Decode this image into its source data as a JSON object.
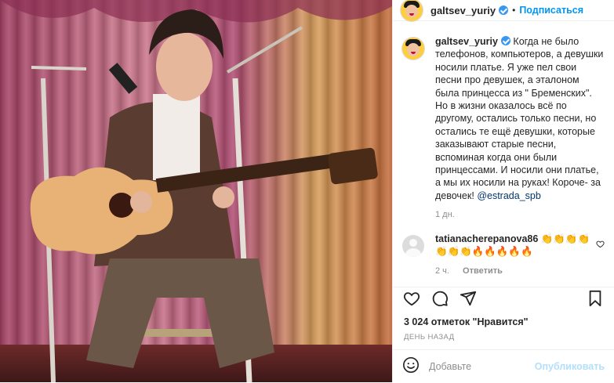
{
  "header": {
    "username": "galtsev_yuriy",
    "separator": "•",
    "follow_label": "Подписаться"
  },
  "caption": {
    "username": "galtsev_yuriy",
    "text": "Когда не было телефонов, компьютеров, а девушки носили платье. Я уже пел свои песни про девушек, а эталоном была принцесса из \" Бременских\". Но в жизни оказалось всё по другому, остались только песни, но остались те ещё девушки, которые заказывают старые песни, вспоминая когда они были принцессами. И носили они платье, а мы их носили на руках! Короче- за девочек! ",
    "mention": "@estrada_spb",
    "time": "1 дн."
  },
  "comment": {
    "username": "tatianacherepanova86",
    "text": "👏👏👏👏👏👏👏🔥🔥🔥🔥🔥",
    "time": "2 ч.",
    "reply_label": "Ответить"
  },
  "likes": "3 024 отметок \"Нравится\"",
  "date": "ДЕНЬ НАЗАД",
  "add_comment": {
    "placeholder": "Добавьте",
    "publish_label": "Опубликовать"
  },
  "icons": {
    "like": "heart-icon",
    "comment": "comment-icon",
    "share": "share-icon",
    "save": "bookmark-icon",
    "emoji": "emoji-icon",
    "comment_like": "heart-icon"
  },
  "colors": {
    "accent": "#0095f6",
    "publish_disabled": "#b2dffc",
    "verified": "#3897f0",
    "muted": "#8e8e8e"
  }
}
